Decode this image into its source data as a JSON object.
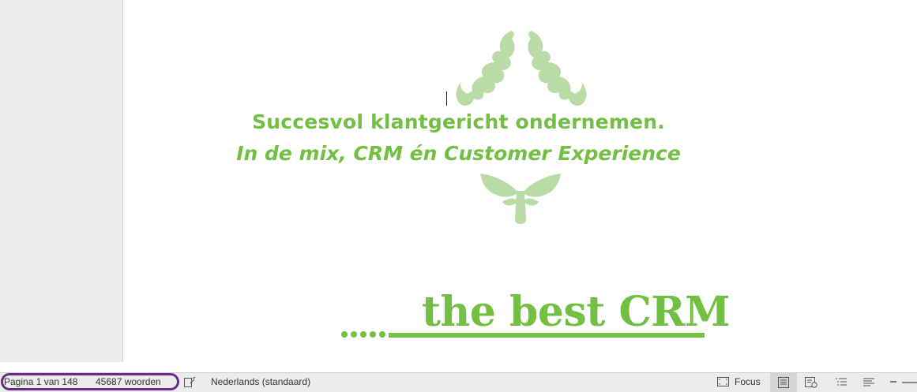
{
  "document": {
    "title": "Succesvol klantgericht ondernemen.",
    "subtitle": "In de mix, CRM én Customer Experience",
    "slogan_dots": ".....",
    "slogan": "the best CRM"
  },
  "status_bar": {
    "page_info": "Pagina 1 van 148",
    "word_count": "45687 woorden",
    "language": "Nederlands (standaard)",
    "focus_label": "Focus"
  },
  "colors": {
    "accent_green": "#72bf44",
    "ornament_green": "#b9dca6",
    "highlight_purple": "#6a2a8c"
  },
  "icons": {
    "proofing": "proofing-icon",
    "focus": "focus-icon",
    "print_layout": "print-layout-icon",
    "web_layout": "web-layout-icon",
    "outline": "outline-icon",
    "draft": "draft-icon",
    "zoom_out": "zoom-out-icon"
  }
}
